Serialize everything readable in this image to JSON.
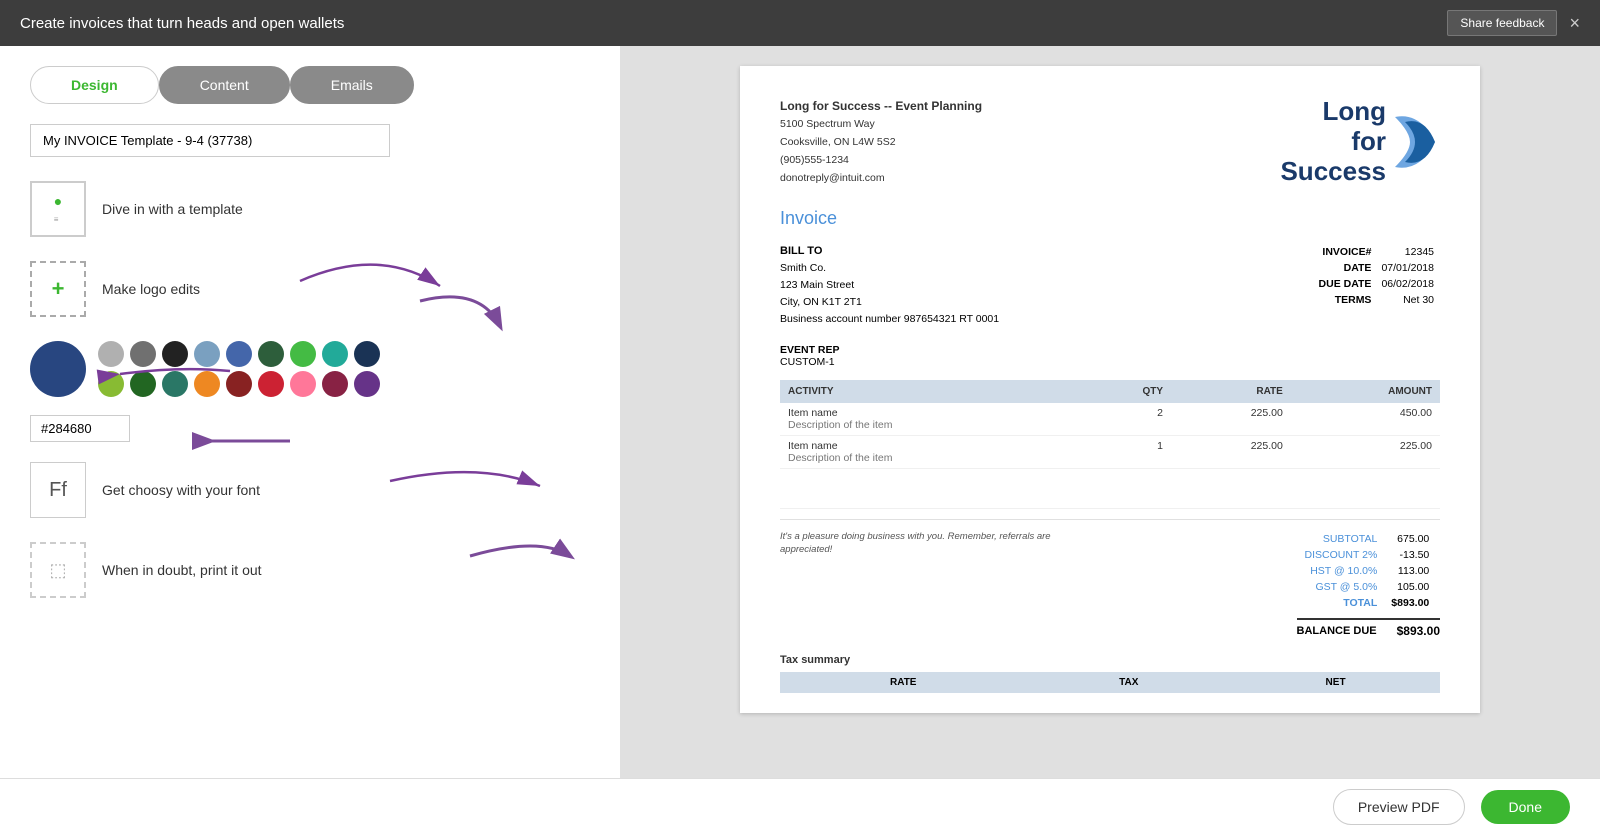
{
  "header": {
    "title": "Create invoices that turn heads and open wallets",
    "share_feedback_label": "Share feedback",
    "close_icon": "×"
  },
  "tabs": [
    {
      "label": "Design",
      "active": true
    },
    {
      "label": "Content",
      "active": false
    },
    {
      "label": "Emails",
      "active": false
    }
  ],
  "template_input": {
    "value": "My INVOICE Template - 9-4 (37738)"
  },
  "features": [
    {
      "id": "template",
      "label": "Dive in with a template"
    },
    {
      "id": "logo",
      "label": "Make logo edits"
    },
    {
      "id": "font",
      "label": "Get choosy with your font"
    },
    {
      "id": "print",
      "label": "When in doubt, print it out"
    }
  ],
  "colors": {
    "selected": "#284680",
    "hex_value": "#284680",
    "swatches_row1": [
      "#b0b0b0",
      "#707070",
      "#222222",
      "#7aa0c0",
      "#5577aa",
      "#446655",
      "#44aa44",
      "#229988",
      "#334466"
    ],
    "swatches_row2": [
      "#88bb44",
      "#336622",
      "#228877",
      "#ee8822",
      "#993322",
      "#cc3344",
      "#ff77aa",
      "#992255",
      "#7733aa"
    ]
  },
  "invoice": {
    "company_name": "Long for Success -- Event Planning",
    "address_line1": "5100 Spectrum Way",
    "address_line2": "Cooksville, ON L4W 5S2",
    "phone": "(905)555-1234",
    "email": "donotreply@intuit.com",
    "logo_text_line1": "Long",
    "logo_text_line2": "for",
    "logo_text_line3": "Success",
    "invoice_label": "Invoice",
    "bill_to_label": "BILL TO",
    "bill_to_name": "Smith Co.",
    "bill_to_address1": "123 Main Street",
    "bill_to_address2": "City, ON K1T 2T1",
    "bill_to_account": "Business account number  987654321 RT 0001",
    "invoice_number_label": "INVOICE#",
    "invoice_number": "12345",
    "date_label": "DATE",
    "date_value": "07/01/2018",
    "due_date_label": "DUE DATE",
    "due_date_value": "06/02/2018",
    "terms_label": "TERMS",
    "terms_value": "Net 30",
    "event_rep_label": "EVENT REP",
    "event_rep_value": "CUSTOM-1",
    "table_headers": [
      "ACTIVITY",
      "QTY",
      "RATE",
      "AMOUNT"
    ],
    "line_items": [
      {
        "name": "Item name",
        "description": "Description of the item",
        "qty": "2",
        "rate": "225.00",
        "amount": "450.00"
      },
      {
        "name": "Item name",
        "description": "Description of the item",
        "qty": "1",
        "rate": "225.00",
        "amount": "225.00"
      }
    ],
    "note": "It's a pleasure doing business with you. Remember, referrals are appreciated!",
    "subtotal_label": "SUBTOTAL",
    "subtotal_value": "675.00",
    "discount_label": "DISCOUNT 2%",
    "discount_value": "-13.50",
    "hst_label": "HST @ 10.0%",
    "hst_value": "113.00",
    "gst_label": "GST @ 5.0%",
    "gst_value": "105.00",
    "total_label": "TOTAL",
    "total_value": "$893.00",
    "balance_due_label": "BALANCE DUE",
    "balance_due_value": "$893.00",
    "tax_summary_label": "Tax summary",
    "tax_headers": [
      "RATE",
      "TAX",
      "NET"
    ]
  },
  "footer": {
    "preview_pdf_label": "Preview PDF",
    "done_label": "Done"
  }
}
